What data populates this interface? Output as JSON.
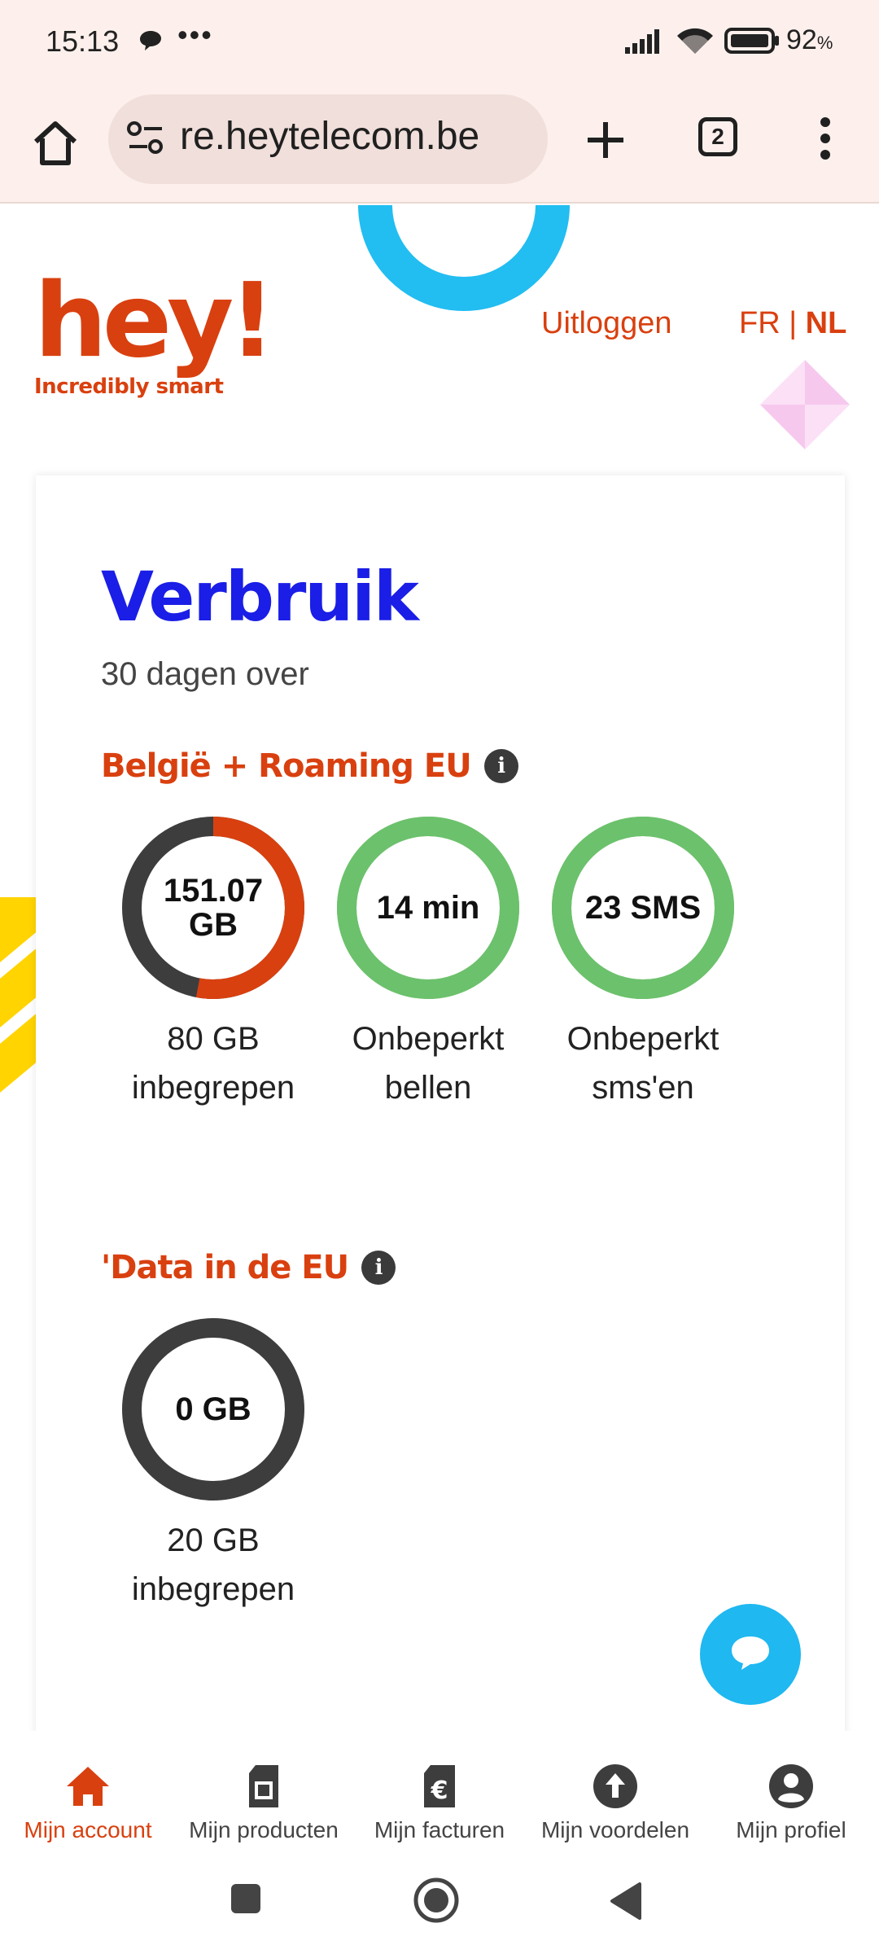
{
  "status_bar": {
    "time": "15:13",
    "dots": "•••",
    "battery": "92",
    "battery_unit": "%"
  },
  "browser": {
    "url": "re.heytelecom.be",
    "tab_count": "2"
  },
  "header": {
    "logo_word": "hey!",
    "logo_tagline": "Incredibly smart",
    "logout": "Uitloggen",
    "lang_fr": "FR",
    "lang_sep": " | ",
    "lang_nl": "NL"
  },
  "card": {
    "title": "Verbruik",
    "subtitle": "30 dagen over",
    "section1": {
      "title": "België + Roaming EU",
      "gauges": [
        {
          "value": "151.07 GB",
          "label_line1": "80 GB",
          "label_line2": "inbegrepen",
          "fraction_used": 0.53,
          "color": "#d9400f",
          "track": "#3d3d3d"
        },
        {
          "value": "14 min",
          "label_line1": "Onbeperkt",
          "label_line2": "bellen",
          "fraction_used": 1.0,
          "color": "#6cc16c",
          "track": "#6cc16c"
        },
        {
          "value": "23 SMS",
          "label_line1": "Onbeperkt",
          "label_line2": "sms'en",
          "fraction_used": 1.0,
          "color": "#6cc16c",
          "track": "#6cc16c"
        }
      ]
    },
    "section2": {
      "title": "'Data in de EU",
      "gauges": [
        {
          "value": "0 GB",
          "label_line1": "20 GB",
          "label_line2": "inbegrepen",
          "fraction_used": 0,
          "color": "#3d3d3d",
          "track": "#3d3d3d"
        }
      ]
    }
  },
  "bottom_nav": [
    {
      "label": "Mijn account",
      "icon": "home-icon",
      "active": true
    },
    {
      "label": "Mijn producten",
      "icon": "sim-card-icon",
      "active": false
    },
    {
      "label": "Mijn facturen",
      "icon": "invoice-euro-icon",
      "active": false
    },
    {
      "label": "Mijn voordelen",
      "icon": "upgrade-arrow-icon",
      "active": false
    },
    {
      "label": "Mijn profiel",
      "icon": "profile-icon",
      "active": false
    }
  ],
  "colors": {
    "brand_orange": "#d9400f",
    "title_blue": "#1a1ee6",
    "accent_cyan": "#22bdf1",
    "green": "#6cc16c"
  }
}
